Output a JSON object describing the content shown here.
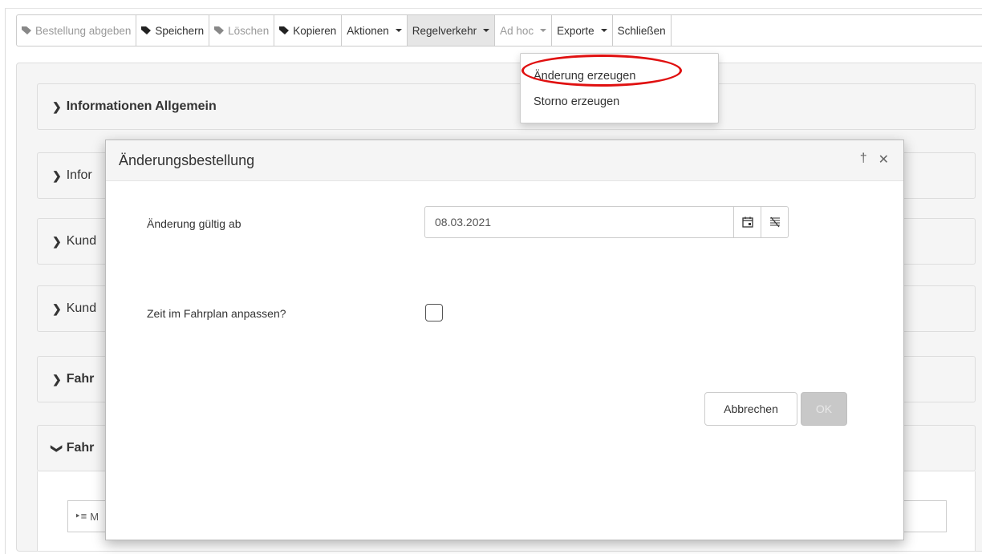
{
  "toolbar": {
    "buttons": [
      {
        "label": "Bestellung abgeben",
        "icon": "tag-icon",
        "state": "disabled"
      },
      {
        "label": "Speichern",
        "icon": "tag-icon",
        "state": "enabled"
      },
      {
        "label": "Löschen",
        "icon": "tag-icon",
        "state": "disabled"
      },
      {
        "label": "Kopieren",
        "icon": "tag-icon",
        "state": "enabled"
      },
      {
        "label": "Aktionen",
        "icon": "caret-down-icon",
        "state": "enabled"
      },
      {
        "label": "Regelverkehr",
        "icon": "caret-down-icon",
        "state": "active"
      },
      {
        "label": "Ad hoc",
        "icon": "caret-down-icon",
        "state": "disabled"
      },
      {
        "label": "Exporte",
        "icon": "caret-down-icon",
        "state": "enabled"
      },
      {
        "label": "Schließen",
        "state": "enabled"
      }
    ]
  },
  "dropdown": {
    "items": [
      "Änderung erzeugen",
      "Storno erzeugen"
    ],
    "highlight_color": "#e01010"
  },
  "panels": [
    {
      "label": "Informationen Allgemein"
    },
    {
      "label": "Infor"
    },
    {
      "label": "Kund"
    },
    {
      "label": "Kund"
    },
    {
      "label": "Fahr"
    },
    {
      "label": "Fahr"
    }
  ],
  "inner_bar": {
    "label": "M"
  },
  "modal": {
    "title": "Änderungsbestellung",
    "field_date_label": "Änderung gültig ab",
    "field_date_value": "08.03.2021",
    "field_checkbox_label": "Zeit im Fahrplan anpassen?",
    "checkbox_checked": false,
    "cancel_label": "Abbrechen",
    "ok_label": "OK",
    "ok_disabled": true
  }
}
